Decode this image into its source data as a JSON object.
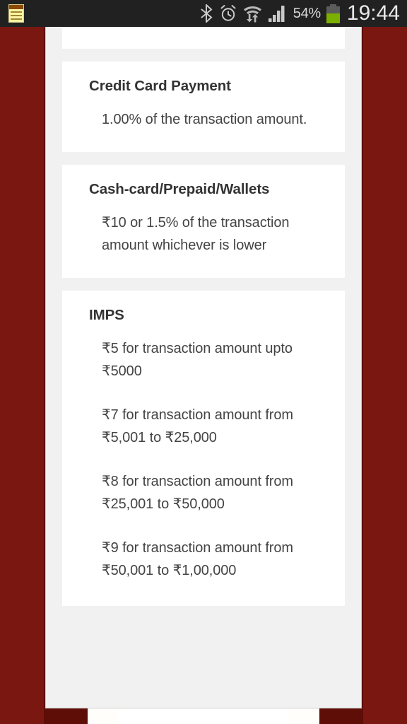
{
  "statusbar": {
    "notification_icon": "memo-notepad-icon",
    "icons": [
      "bluetooth-icon",
      "alarm-clock-icon",
      "wifi-data-transfer-icon",
      "cellular-signal-icon"
    ],
    "battery_percent": "54%",
    "battery_icon": "battery-icon",
    "battery_fill_color": "#7bb000",
    "clock": "19:44",
    "background_color": "#212121"
  },
  "theme": {
    "band_outer": "#7a1710",
    "band_inner": "#5e0d07",
    "band_cream": "#fffefb",
    "container_bg": "#f1f1f1",
    "panel_bg": "#ffffff",
    "title_color": "#333333",
    "body_color": "#444444"
  },
  "cards": [
    {
      "title": "Credit Card Payment",
      "paragraphs": [
        "1.00% of the transaction amount."
      ]
    },
    {
      "title": "Cash-card/Prepaid/Wallets",
      "paragraphs": [
        "₹10 or 1.5% of the transaction amount whichever is lower"
      ]
    },
    {
      "title": "IMPS",
      "paragraphs": [
        "₹5 for transaction amount upto ₹5000",
        "₹7 for transaction amount from ₹5,001 to ₹25,000",
        "₹8 for transaction amount from ₹25,001 to ₹50,000",
        "₹9 for transaction amount from ₹50,001 to ₹1,00,000"
      ]
    }
  ]
}
